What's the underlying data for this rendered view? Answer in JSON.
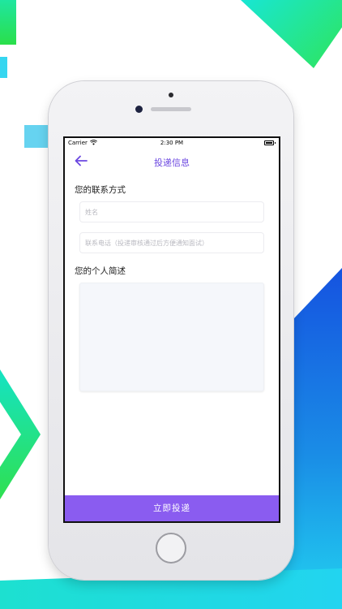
{
  "status_bar": {
    "carrier": "Carrier",
    "time": "2:30 PM"
  },
  "nav": {
    "title": "投递信息"
  },
  "contact_section": {
    "title": "您的联系方式",
    "name_placeholder": "姓名",
    "phone_placeholder": "联系电话（投递审核通过后方便通知面试）"
  },
  "intro_section": {
    "title": "您的个人简述"
  },
  "submit_label": "立即投递",
  "colors": {
    "accent": "#6b47e0",
    "button": "#8a5cf0"
  }
}
